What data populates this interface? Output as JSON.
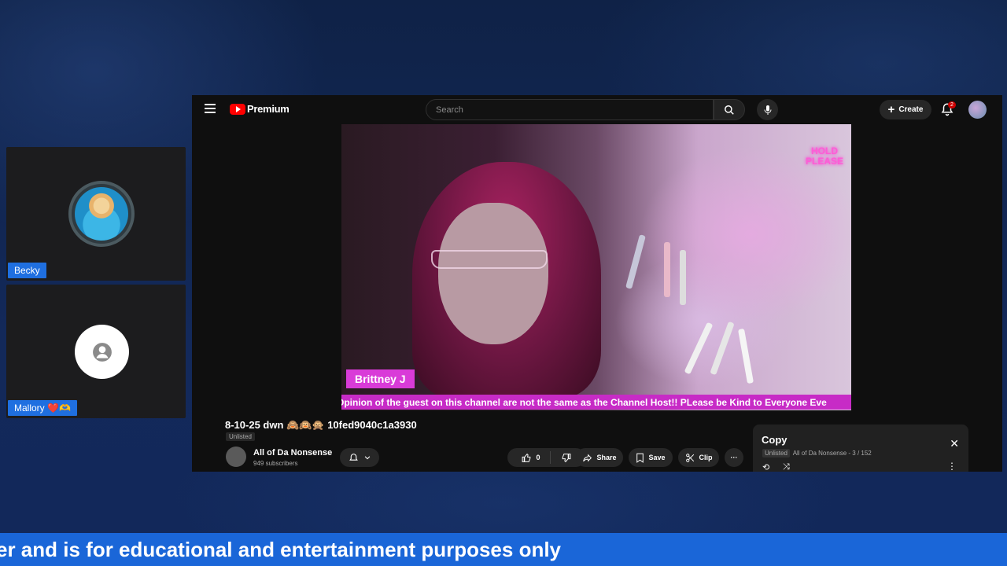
{
  "participants": [
    {
      "name": "Becky",
      "avatar": "profile-photo"
    },
    {
      "name": "Mallory ❤️🫶",
      "avatar": "default-person-icon"
    }
  ],
  "youtube": {
    "logo_text": "Premium",
    "search": {
      "placeholder": "Search"
    },
    "create_label": "Create",
    "notification_count": "2",
    "video": {
      "overlay_top_right_line1": "HOLD",
      "overlay_top_right_line2": "PLEASE",
      "lower_third_name": "Brittney J",
      "ticker_text": "Opinion of the guest on this channel are not the same as the Channel Host!! PLease be Kind to Everyone Eve"
    },
    "title": "8-10-25 dwn 🙈🙉🙊 10fed9040c1a3930",
    "visibility": "Unlisted",
    "channel": {
      "name": "All of Da Nonsense",
      "subscribers": "949 subscribers"
    },
    "actions": {
      "like_count": "0",
      "share": "Share",
      "save": "Save",
      "clip": "Clip",
      "more": "···"
    },
    "playlist": {
      "title": "Copy",
      "visibility": "Unlisted",
      "owner_position": "All of Da Nonsense - 3 / 152"
    }
  },
  "banner_text": "er and is for educational and entertainment purposes only",
  "colors": {
    "background": "#0e2148",
    "name_tag": "#1f6fe0",
    "banner": "#1a66d8",
    "lower_third": "#d93bd8",
    "youtube_red": "#ff0000"
  }
}
